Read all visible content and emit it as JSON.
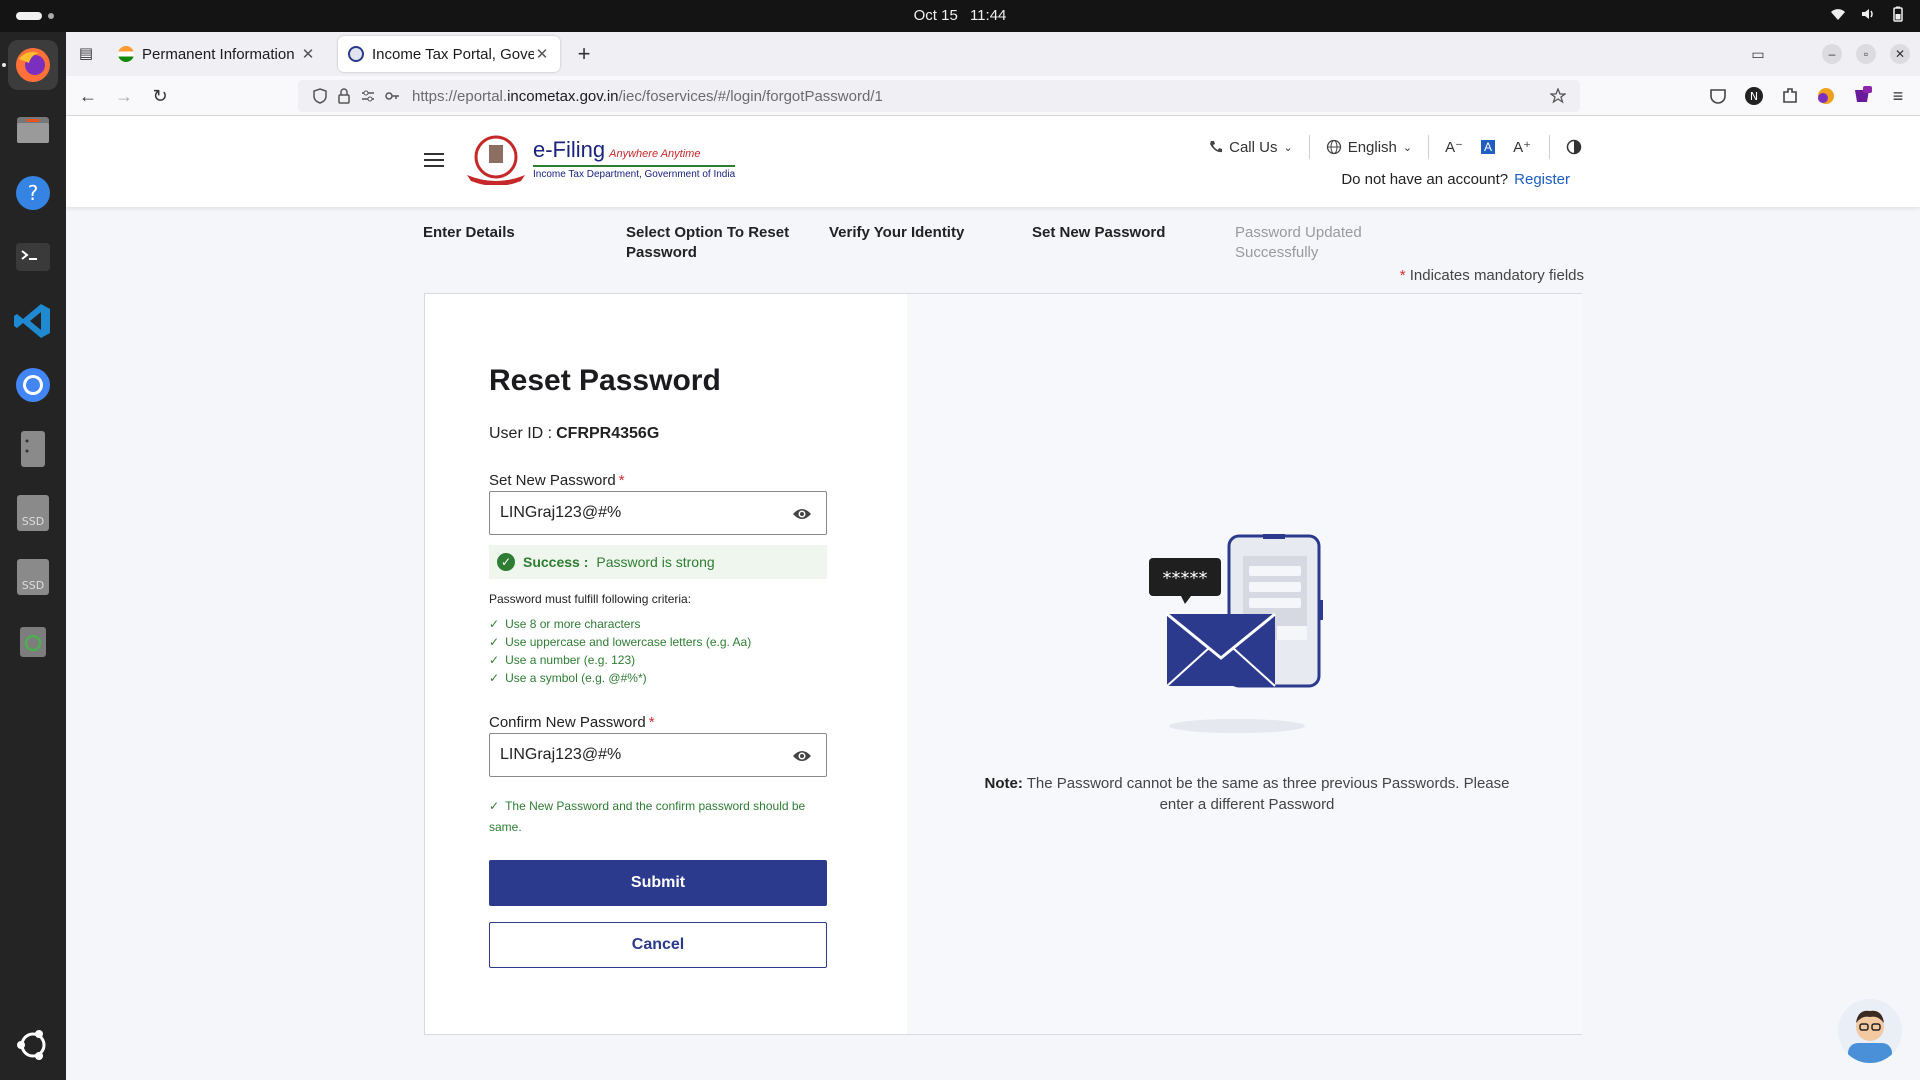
{
  "system": {
    "date": "Oct 15",
    "time": "11:44"
  },
  "browser": {
    "tabs": [
      {
        "label": "Permanent Information",
        "active": false
      },
      {
        "label": "Income Tax Portal, Gover",
        "active": true
      }
    ],
    "url_prefix": "https://eportal.",
    "url_domain": "incometax.gov.in",
    "url_path": "/iec/foservices/#/login/forgotPassword/1"
  },
  "header": {
    "brand": "e-Filing",
    "tagline": "Anywhere Anytime",
    "subtitle": "Income Tax Department, Government of India",
    "call_us": "Call Us",
    "language": "English",
    "account_prompt": "Do not have an account?",
    "register_link": "Register"
  },
  "steps": [
    {
      "label": "Enter Details",
      "state": "done"
    },
    {
      "label": "Select Option To Reset Password",
      "state": "done"
    },
    {
      "label": "Verify Your Identity",
      "state": "done"
    },
    {
      "label": "Set New Password",
      "state": "current"
    },
    {
      "label": "Password Updated Successfully",
      "state": "pending"
    }
  ],
  "mandatory_note": "Indicates mandatory fields",
  "form": {
    "title": "Reset Password",
    "user_id_label": "User ID :",
    "user_id_value": "CFRPR4356G",
    "new_password_label": "Set New Password",
    "new_password_value": "LINGraj123@#%",
    "strength_label": "Success :",
    "strength_message": "Password is strong",
    "criteria_title": "Password must fulfill following criteria:",
    "criteria": [
      "Use 8 or more characters",
      "Use uppercase and lowercase letters (e.g. Aa)",
      "Use a number (e.g. 123)",
      "Use a symbol (e.g. @#%*)"
    ],
    "confirm_password_label": "Confirm New Password",
    "confirm_password_value": "LINGraj123@#%",
    "match_message": "The New Password and the confirm password should be same.",
    "submit_label": "Submit",
    "cancel_label": "Cancel"
  },
  "illustration": {
    "masked_text": "*****"
  },
  "note": {
    "label": "Note:",
    "text": "The Password cannot be the same as three previous Passwords. Please enter a different Password"
  },
  "colors": {
    "primary": "#2b3a8c",
    "success": "#2e7d32",
    "required": "#d32f2f",
    "link": "#1f5fbf"
  }
}
